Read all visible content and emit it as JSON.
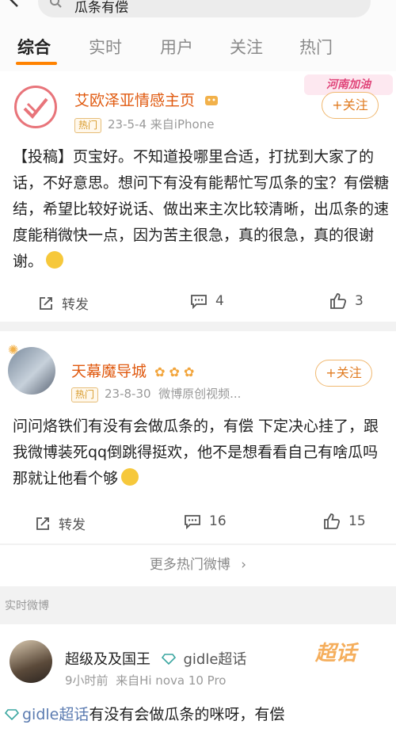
{
  "header": {
    "search_text": "瓜条有偿",
    "tabs": [
      {
        "label": "综合",
        "active": true
      },
      {
        "label": "实时",
        "active": false
      },
      {
        "label": "用户",
        "active": false
      },
      {
        "label": "关注",
        "active": false
      },
      {
        "label": "热门",
        "active": false
      }
    ],
    "accent_color": "#ff8200"
  },
  "posts": [
    {
      "user_name": "艾欧泽亚情感主页",
      "badge": "热门",
      "date": "23-5-4",
      "source": "来自iPhone",
      "follow_label": "+关注",
      "sticker_text": "河南加油",
      "text": "【投稿】页宝好。不知道投哪里合适，打扰到大家了的话，不好意思。想问下有没有能帮忙写瓜条的宝？有偿糖结，希望比较好说话、做出来主次比较清晰，出瓜条的速度能稍微快一点，因为苦主很急，真的很急，真的很谢谢。",
      "repost_label": "转发",
      "comments": "4",
      "likes": "3"
    },
    {
      "user_name": "天幕魔导城",
      "badge": "热门",
      "date": "23-8-30",
      "source": "微博原创视频...",
      "follow_label": "+关注",
      "text": "问问烙铁们有没有会做瓜条的，有偿 下定决心挂了，跟我微博装死qq倒跳得挺欢，他不是想看看自己有啥瓜吗那就让他看个够",
      "repost_label": "转发",
      "comments": "16",
      "likes": "15"
    }
  ],
  "more_hot_label": "更多热门微博",
  "section_label": "实时微博",
  "realtime_post": {
    "user_name": "超级及及国王",
    "supertopic": "gidle超话",
    "time": "9小时前",
    "source": "来自Hi nova 10 Pro",
    "stamp_text": "超话",
    "text_topic": "gidle超话",
    "text_rest": "有没有会做瓜条的咪呀，有偿"
  }
}
